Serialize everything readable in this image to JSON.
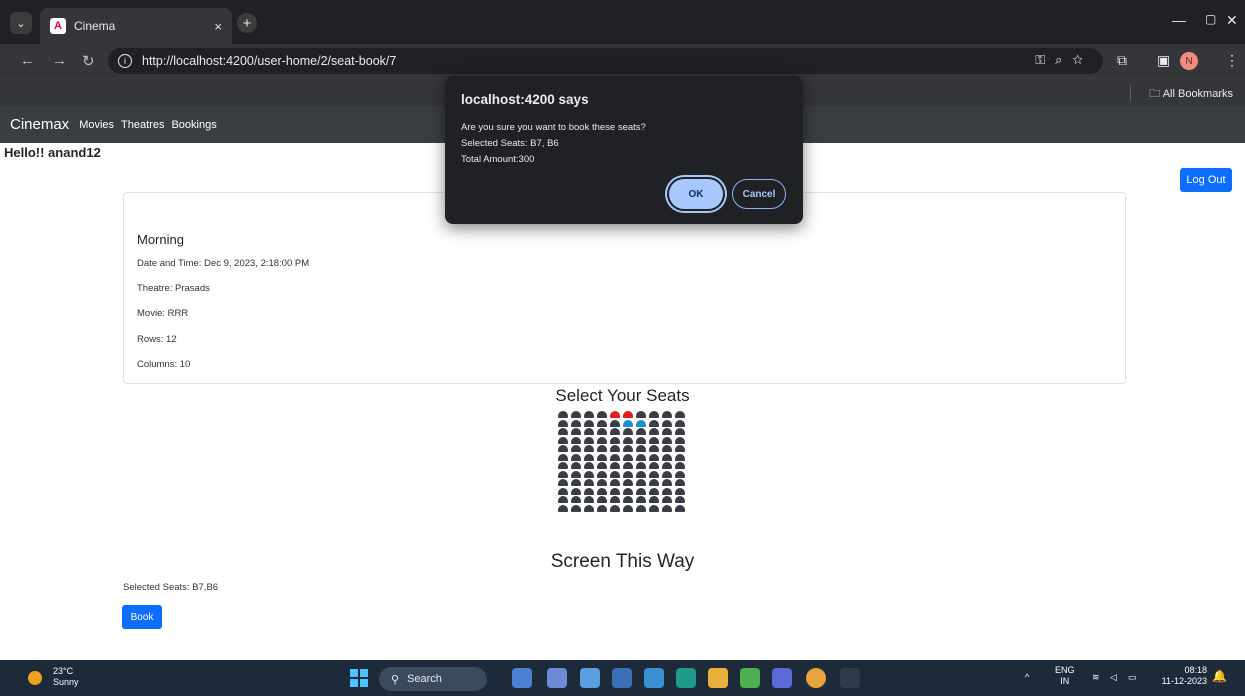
{
  "browser": {
    "tab_title": "Cinema",
    "tab_close": "×",
    "new_tab": "+",
    "url": "http://localhost:4200/user-home/2/seat-book/7",
    "profile_initial": "N",
    "all_bookmarks": "All Bookmarks"
  },
  "app": {
    "brand": "Cinemax",
    "nav": [
      "Movies",
      "Theatres",
      "Bookings"
    ],
    "greeting": "Hello!! anand12",
    "logout": "Log Out"
  },
  "show": {
    "name": "Morning",
    "datetime": "Date and Time: Dec 9, 2023, 2:18:00 PM",
    "theatre": "Theatre: Prasads",
    "movie": "Movie: RRR",
    "rows": "Rows: 12",
    "columns": "Columns: 10"
  },
  "seat_map": {
    "title": "Select Your Seats",
    "rows": 12,
    "columns": 10,
    "booked": [
      [
        0,
        4
      ],
      [
        0,
        5
      ]
    ],
    "selected": [
      [
        1,
        5
      ],
      [
        1,
        6
      ]
    ],
    "colors": {
      "available": "#3a3d45",
      "booked": "#e21c1c",
      "selected": "#1a8fd6"
    },
    "screen_label": "Screen This Way"
  },
  "booking": {
    "selected_seats": "Selected Seats: B7,B6",
    "book_label": "Book"
  },
  "dialog": {
    "title": "localhost:4200 says",
    "message": "Are you sure you want to book these seats?\nSelected Seats: B7, B6\nTotal Amount:300",
    "ok": "OK",
    "cancel": "Cancel"
  },
  "taskbar": {
    "temp": "23°C",
    "weather": "Sunny",
    "search": "Search",
    "lang": "ENG",
    "region": "IN",
    "time": "08:18",
    "date": "11-12-2023"
  }
}
